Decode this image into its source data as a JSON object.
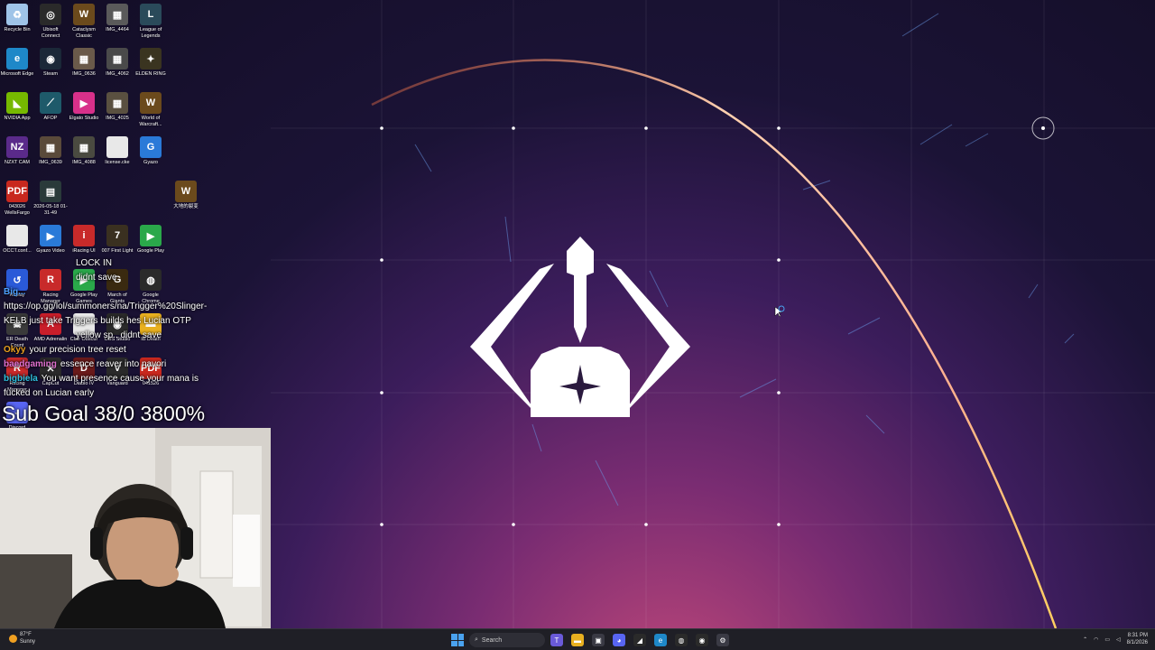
{
  "desktop_icons": [
    {
      "label": "Recycle Bin",
      "icon": "recycle-bin-icon",
      "color": "#9fc4e8",
      "glyph": "♻"
    },
    {
      "label": "Ubisoft Connect",
      "icon": "ubisoft-icon",
      "color": "#2a2a2a",
      "glyph": "◎"
    },
    {
      "label": "Cataclysm Classic",
      "icon": "wow-icon",
      "color": "#6b4a1c",
      "glyph": "W"
    },
    {
      "label": "IMG_4464",
      "icon": "photo-icon",
      "color": "#5a5a5a",
      "glyph": "▦"
    },
    {
      "label": "League of Legends",
      "icon": "lol-icon",
      "color": "#2a4a5a",
      "glyph": "L"
    },
    {
      "label": "Microsoft Edge",
      "icon": "edge-icon",
      "color": "#1e88c8",
      "glyph": "e"
    },
    {
      "label": "Steam",
      "icon": "steam-icon",
      "color": "#1b2838",
      "glyph": "◉"
    },
    {
      "label": "IMG_0636",
      "icon": "photo-icon",
      "color": "#6a5a4a",
      "glyph": "▦"
    },
    {
      "label": "IMG_4062",
      "icon": "photo-icon",
      "color": "#4a4a4a",
      "glyph": "▦"
    },
    {
      "label": "ELDEN RING",
      "icon": "elden-ring-icon",
      "color": "#3a3420",
      "glyph": "✦"
    },
    {
      "label": "NVIDIA App",
      "icon": "nvidia-icon",
      "color": "#76b900",
      "glyph": "◣"
    },
    {
      "label": "AFOP",
      "icon": "afop-icon",
      "color": "#1e5a6a",
      "glyph": "⟋"
    },
    {
      "label": "Elgato Studio",
      "icon": "elgato-icon",
      "color": "#d8308a",
      "glyph": "▶"
    },
    {
      "label": "IMG_4025",
      "icon": "photo-icon",
      "color": "#5a5040",
      "glyph": "▦"
    },
    {
      "label": "World of Warcraft...",
      "icon": "wow-icon",
      "color": "#6b4a1c",
      "glyph": "W"
    },
    {
      "label": "NZXT CAM",
      "icon": "nzxt-icon",
      "color": "#5a2a8a",
      "glyph": "NZ"
    },
    {
      "label": "IMG_0639",
      "icon": "photo-icon",
      "color": "#5a4a3a",
      "glyph": "▦"
    },
    {
      "label": "IMG_4088",
      "icon": "photo-icon",
      "color": "#4a4a40",
      "glyph": "▦"
    },
    {
      "label": "license.cke",
      "icon": "file-icon",
      "color": "#e8e8e8",
      "glyph": ""
    },
    {
      "label": "Gyazo",
      "icon": "gyazo-icon",
      "color": "#2a7ad8",
      "glyph": "G"
    },
    {
      "label": "043026 WellsFargo",
      "icon": "pdf-icon",
      "color": "#c8281e",
      "glyph": "PDF"
    },
    {
      "label": "2026-05-18 01-31-49",
      "icon": "video-icon",
      "color": "#2a3a3a",
      "glyph": "▤"
    },
    {
      "label": "大地的裂变",
      "icon": "wow-icon",
      "color": "#6b4a1c",
      "glyph": "W"
    },
    {
      "label": "OCCT.conf...",
      "icon": "file-icon",
      "color": "#e8e8e8",
      "glyph": ""
    },
    {
      "label": "Gyazo Video",
      "icon": "gyazo-video-icon",
      "color": "#2a7ad8",
      "glyph": "▶"
    },
    {
      "label": "iRacing UI",
      "icon": "iracing-icon",
      "color": "#c82a2a",
      "glyph": "i"
    },
    {
      "label": "007 First Light",
      "icon": "game-icon",
      "color": "#3a3020",
      "glyph": "7"
    },
    {
      "label": "Google Play",
      "icon": "google-play-icon",
      "color": "#2aa84a",
      "glyph": "▶"
    },
    {
      "label": "Replay",
      "icon": "replay-icon",
      "color": "#2a5ad8",
      "glyph": "↺"
    },
    {
      "label": "Racing Manager",
      "icon": "racing-icon",
      "color": "#c82a2a",
      "glyph": "R"
    },
    {
      "label": "Google Play Games",
      "icon": "google-play-icon",
      "color": "#2aa84a",
      "glyph": "▶"
    },
    {
      "label": "March of Giants",
      "icon": "game-icon",
      "color": "#3a2a10",
      "glyph": "G"
    },
    {
      "label": "Google Chrome",
      "icon": "chrome-icon",
      "color": "#2a2a2a",
      "glyph": "◍"
    },
    {
      "label": "ER Death Count",
      "icon": "game-icon",
      "color": "#3a3a3a",
      "glyph": "☠"
    },
    {
      "label": "AMD Adrenalin",
      "icon": "amd-icon",
      "color": "#c81e2a",
      "glyph": "A"
    },
    {
      "label": "Clair Obscur",
      "icon": "file-icon",
      "color": "#e8e8e8",
      "glyph": ""
    },
    {
      "label": "OBS Studio",
      "icon": "obs-icon",
      "color": "#2a2a2a",
      "glyph": "◉"
    },
    {
      "label": "IB Death",
      "icon": "folder-icon",
      "color": "#e8b020",
      "glyph": "▬"
    },
    {
      "label": "Racing Manager",
      "icon": "racing-icon",
      "color": "#c82a2a",
      "glyph": "R"
    },
    {
      "label": "CapCut",
      "icon": "capcut-icon",
      "color": "#2a2a2a",
      "glyph": "✕"
    },
    {
      "label": "Diablo IV",
      "icon": "diablo-icon",
      "color": "#6a1a1a",
      "glyph": "D"
    },
    {
      "label": "Vanguard",
      "icon": "vanguard-icon",
      "color": "#2a2a2a",
      "glyph": "V"
    },
    {
      "label": "041526",
      "icon": "pdf-icon",
      "color": "#c8281e",
      "glyph": "PDF"
    },
    {
      "label": "Discord",
      "icon": "discord-icon",
      "color": "#5865f2",
      "glyph": "◕"
    }
  ],
  "chat": [
    {
      "user": "",
      "text": "LOCK IN",
      "color": "#ffffff"
    },
    {
      "user": "",
      "text": "didnt save",
      "color": "#ffffff"
    },
    {
      "user": "Big...",
      "text": "",
      "color": "#4ea0ff"
    },
    {
      "user": "",
      "text": "https://op.gg/lol/summoners/na/Trigger%20Slinger-KELB just take Triggers builds hes Lucian OTP",
      "color": "#ffffff"
    },
    {
      "user": "",
      "text": "yellow sp.. didnt save",
      "color": "#ffffff"
    },
    {
      "user": "Okyy",
      "text": "your precision tree reset",
      "color": "#e8a020"
    },
    {
      "user": "baedgaming",
      "text": "essence reaver into navori",
      "color": "#e070d0"
    },
    {
      "user": "bigbiela",
      "text": "You want presence cause your mana is fucked on Lucian early",
      "color": "#30c0e0"
    }
  ],
  "subgoal": "Sub Goal 38/0 3800%",
  "taskbar": {
    "weather_temp": "87°F",
    "weather_desc": "Sunny",
    "search_placeholder": "Search",
    "time": "8:31 PM",
    "date": "8/1/2026",
    "apps": [
      {
        "icon": "teams-icon",
        "color": "#6a5ad8",
        "glyph": "T"
      },
      {
        "icon": "file-explorer-icon",
        "color": "#e8b020",
        "glyph": "▬"
      },
      {
        "icon": "task-view-icon",
        "color": "#3a3a44",
        "glyph": "▣"
      },
      {
        "icon": "discord-icon",
        "color": "#5865f2",
        "glyph": "◕"
      },
      {
        "icon": "elgato-icon",
        "color": "#2a2a2a",
        "glyph": "◢"
      },
      {
        "icon": "edge-icon",
        "color": "#1e88c8",
        "glyph": "e"
      },
      {
        "icon": "chrome-icon",
        "color": "#2a2a2a",
        "glyph": "◍"
      },
      {
        "icon": "obs-icon",
        "color": "#2a2a2a",
        "glyph": "◉"
      },
      {
        "icon": "settings-icon",
        "color": "#3a3a44",
        "glyph": "⚙"
      }
    ]
  }
}
